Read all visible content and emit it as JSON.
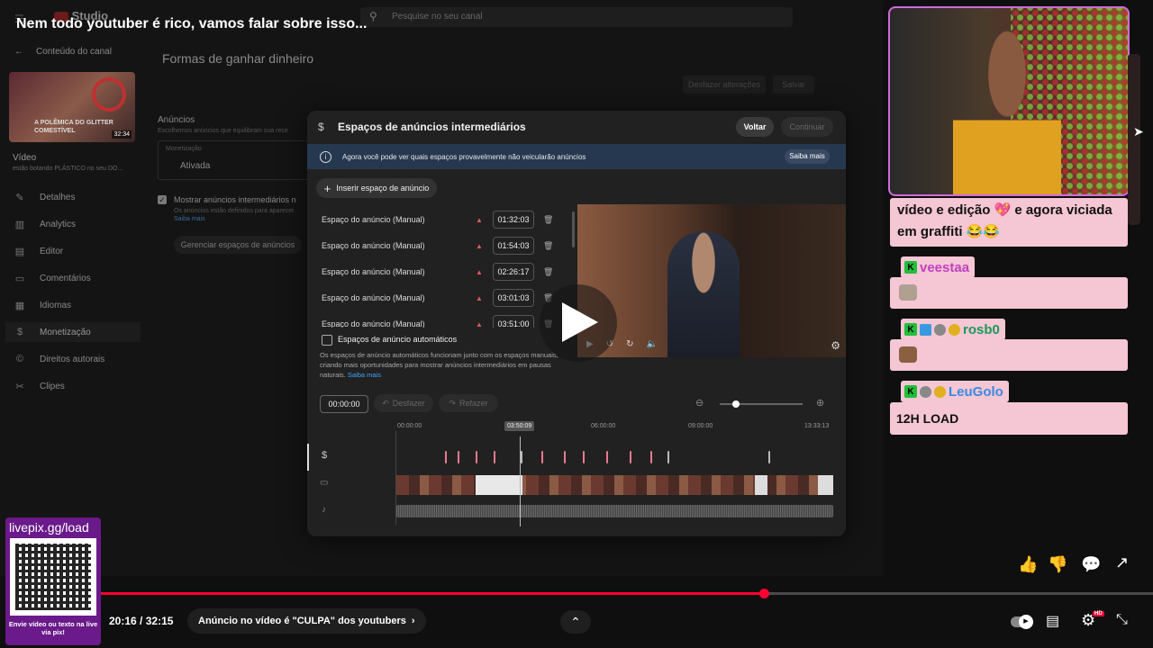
{
  "video": {
    "title": "Nem todo youtuber é rico, vamos falar sobre isso...",
    "time_current": "20:16",
    "time_sep": " / ",
    "time_total": "32:15",
    "chapter": "Anúncio no vídeo é \"CULPA\" dos youtubers",
    "progress": 0.63
  },
  "studio": {
    "logo": "Studio",
    "search_placeholder": "Pesquise no seu canal",
    "back_label": "Conteúdo do canal",
    "thumb_caption": "A POLÊMICA DO GLITTER COMESTÍVEL",
    "thumb_duration": "32:34",
    "video_label": "Vídeo",
    "video_sub": "estão botando PLÁSTICO no seu DO...",
    "nav": [
      {
        "icon": "pencil-icon",
        "glyph": "✎",
        "label": "Detalhes"
      },
      {
        "icon": "analytics-icon",
        "glyph": "▥",
        "label": "Analytics"
      },
      {
        "icon": "editor-icon",
        "glyph": "▤",
        "label": "Editor"
      },
      {
        "icon": "comments-icon",
        "glyph": "▭",
        "label": "Comentários"
      },
      {
        "icon": "languages-icon",
        "glyph": "▦",
        "label": "Idiomas"
      },
      {
        "icon": "dollar-icon",
        "glyph": "$",
        "label": "Monetização"
      },
      {
        "icon": "copyright-icon",
        "glyph": "©",
        "label": "Direitos autorais"
      },
      {
        "icon": "scissors-icon",
        "glyph": "✂",
        "label": "Clipes"
      }
    ],
    "page_title": "Formas de ganhar dinheiro",
    "discard_label": "Desfazer alterações",
    "save_label": "Salvar",
    "ads_heading": "Anúncios",
    "ads_sub": "Escolhemos anúncios que equilibram sua rece",
    "monet_label": "Monetização",
    "monet_value": "Ativada",
    "midroll_check": "Mostrar anúncios intermediários n",
    "midroll_sub": "Os anúncios estão definidos para aparecer",
    "learn_more": "Saiba mais",
    "manage_label": "Gerenciar espaços de anúncios"
  },
  "modal": {
    "title": "Espaços de anúncios intermediários",
    "back_btn": "Voltar",
    "continue_btn": "Continuar",
    "info": "Agora você pode ver quais espaços provavelmente não veicularão anúncios",
    "info_learn": "Saiba mais",
    "insert_btn": "Inserir espaço de anúncio",
    "slots": [
      {
        "label": "Espaço do anúncio (Manual)",
        "time": "01:32:03"
      },
      {
        "label": "Espaço do anúncio (Manual)",
        "time": "01:54:03"
      },
      {
        "label": "Espaço do anúncio (Manual)",
        "time": "02:26:17"
      },
      {
        "label": "Espaço do anúncio (Manual)",
        "time": "03:01:03"
      },
      {
        "label": "Espaço do anúncio (Manual)",
        "time": "03:51:00"
      }
    ],
    "auto_label": "Espaços de anúncio automáticos",
    "auto_desc": "Os espaços de anúncio automáticos funcionam junto com os espaços manuais, criando mais oportunidades para mostrar anúncios intermediários em pausas naturais.",
    "auto_learn": "Saiba mais",
    "timecode": "00:00:00",
    "undo": "Desfazer",
    "redo": "Refazer",
    "ruler": [
      "00:00:00",
      "03:50:09",
      "06:00:00",
      "09:00:00",
      "13:33:13"
    ],
    "zoom_level": 0.2
  },
  "overlay": {
    "donate_url": "livepix.gg/load",
    "donate_caption": "Envie vídeo ou texto na live via pix!"
  },
  "chat": {
    "messages": [
      {
        "user": "",
        "text": "vídeo e edição 💖 e agora viciada em graffiti 😂😂"
      },
      {
        "user": "veestaa",
        "text": ""
      },
      {
        "user": "rosb0",
        "text": ""
      },
      {
        "user": "LeuGolo",
        "text": "12H LOAD"
      }
    ]
  },
  "colors": {
    "accent_red": "#ff0033",
    "chat_pink": "#f5c6d4",
    "marker_pink": "#ea7a8c",
    "badge_green": "#1fbf3a",
    "info_blue": "#263850"
  }
}
